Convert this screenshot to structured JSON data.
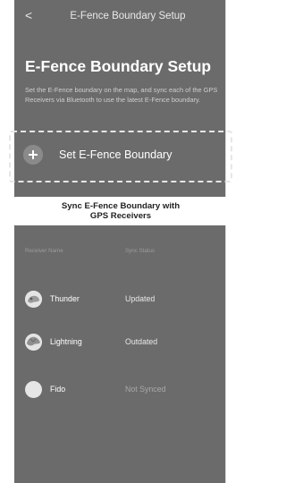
{
  "topbar": {
    "back_glyph": "<",
    "title": "E-Fence Boundary Setup"
  },
  "page_title": "E-Fence Boundary Setup",
  "description": "Set the E-Fence boundary on the map, and sync each of the GPS Receivers via Bluetooth to use the latest E-Fence boundary.",
  "set_boundary": {
    "label": "Set E-Fence Boundary",
    "icon": "plus-circle-icon"
  },
  "sync_button": {
    "line1": "Sync E-Fence Boundary with",
    "line2": "GPS Receivers"
  },
  "table": {
    "headers": {
      "name": "Receiver Name",
      "status": "Sync Status"
    },
    "rows": [
      {
        "name": "Thunder",
        "status": "Updated",
        "avatar": "dog-avatar-icon"
      },
      {
        "name": "Lightning",
        "status": "Outdated",
        "avatar": "dog-avatar-icon"
      },
      {
        "name": "Fido",
        "status": "Not Synced",
        "avatar": "blank-avatar-icon"
      }
    ]
  },
  "colors": {
    "background": "#6b6b6b",
    "status_updated": "#e8e8e8",
    "status_outdated": "#e8e8e8",
    "status_not_synced": "#a8a8a8"
  }
}
